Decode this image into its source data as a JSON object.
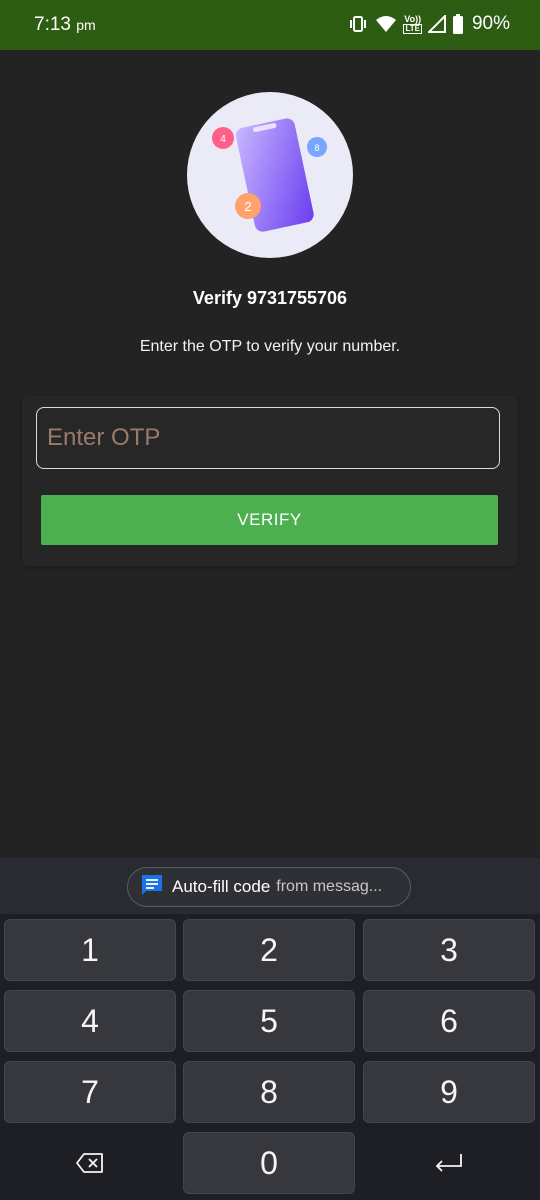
{
  "status_bar": {
    "time": "7:13",
    "ampm": "pm",
    "battery": "90%",
    "volte_label": "Vo))",
    "lte_label": "LTE",
    "background": "#2c5d13"
  },
  "hero": {
    "badges": [
      "4",
      "8",
      "2"
    ]
  },
  "verify": {
    "title": "Verify 9731755706",
    "subtitle": "Enter the OTP to verify your number.",
    "otp_placeholder": "Enter OTP",
    "button_label": "VERIFY",
    "button_color": "#4caf50"
  },
  "keyboard": {
    "autofill_main": "Auto-fill code",
    "autofill_rest": "from messag...",
    "keys": [
      "1",
      "2",
      "3",
      "4",
      "5",
      "6",
      "7",
      "8",
      "9",
      "0"
    ],
    "backspace_icon": "backspace-icon",
    "enter_icon": "enter-icon"
  }
}
